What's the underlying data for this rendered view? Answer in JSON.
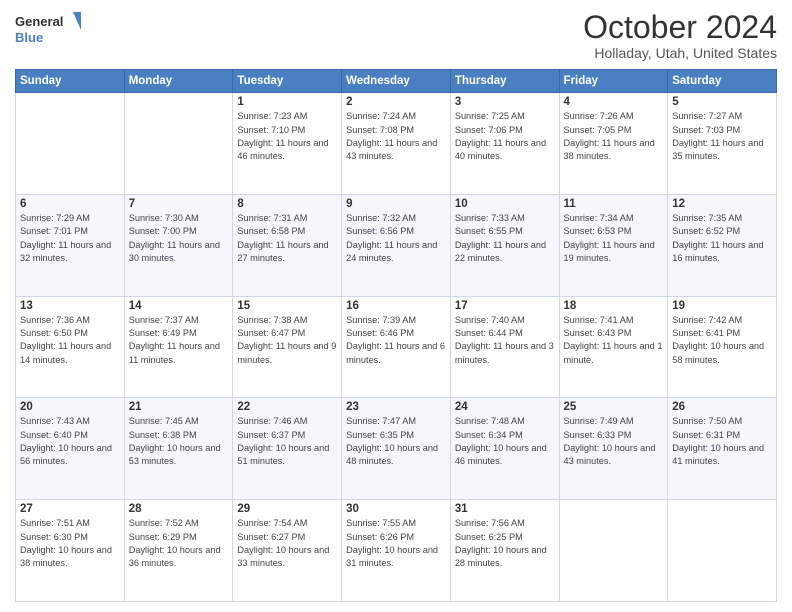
{
  "header": {
    "logo_line1": "General",
    "logo_line2": "Blue",
    "month": "October 2024",
    "location": "Holladay, Utah, United States"
  },
  "weekdays": [
    "Sunday",
    "Monday",
    "Tuesday",
    "Wednesday",
    "Thursday",
    "Friday",
    "Saturday"
  ],
  "weeks": [
    [
      {
        "day": "",
        "sunrise": "",
        "sunset": "",
        "daylight": ""
      },
      {
        "day": "",
        "sunrise": "",
        "sunset": "",
        "daylight": ""
      },
      {
        "day": "1",
        "sunrise": "Sunrise: 7:23 AM",
        "sunset": "Sunset: 7:10 PM",
        "daylight": "Daylight: 11 hours and 46 minutes."
      },
      {
        "day": "2",
        "sunrise": "Sunrise: 7:24 AM",
        "sunset": "Sunset: 7:08 PM",
        "daylight": "Daylight: 11 hours and 43 minutes."
      },
      {
        "day": "3",
        "sunrise": "Sunrise: 7:25 AM",
        "sunset": "Sunset: 7:06 PM",
        "daylight": "Daylight: 11 hours and 40 minutes."
      },
      {
        "day": "4",
        "sunrise": "Sunrise: 7:26 AM",
        "sunset": "Sunset: 7:05 PM",
        "daylight": "Daylight: 11 hours and 38 minutes."
      },
      {
        "day": "5",
        "sunrise": "Sunrise: 7:27 AM",
        "sunset": "Sunset: 7:03 PM",
        "daylight": "Daylight: 11 hours and 35 minutes."
      }
    ],
    [
      {
        "day": "6",
        "sunrise": "Sunrise: 7:29 AM",
        "sunset": "Sunset: 7:01 PM",
        "daylight": "Daylight: 11 hours and 32 minutes."
      },
      {
        "day": "7",
        "sunrise": "Sunrise: 7:30 AM",
        "sunset": "Sunset: 7:00 PM",
        "daylight": "Daylight: 11 hours and 30 minutes."
      },
      {
        "day": "8",
        "sunrise": "Sunrise: 7:31 AM",
        "sunset": "Sunset: 6:58 PM",
        "daylight": "Daylight: 11 hours and 27 minutes."
      },
      {
        "day": "9",
        "sunrise": "Sunrise: 7:32 AM",
        "sunset": "Sunset: 6:56 PM",
        "daylight": "Daylight: 11 hours and 24 minutes."
      },
      {
        "day": "10",
        "sunrise": "Sunrise: 7:33 AM",
        "sunset": "Sunset: 6:55 PM",
        "daylight": "Daylight: 11 hours and 22 minutes."
      },
      {
        "day": "11",
        "sunrise": "Sunrise: 7:34 AM",
        "sunset": "Sunset: 6:53 PM",
        "daylight": "Daylight: 11 hours and 19 minutes."
      },
      {
        "day": "12",
        "sunrise": "Sunrise: 7:35 AM",
        "sunset": "Sunset: 6:52 PM",
        "daylight": "Daylight: 11 hours and 16 minutes."
      }
    ],
    [
      {
        "day": "13",
        "sunrise": "Sunrise: 7:36 AM",
        "sunset": "Sunset: 6:50 PM",
        "daylight": "Daylight: 11 hours and 14 minutes."
      },
      {
        "day": "14",
        "sunrise": "Sunrise: 7:37 AM",
        "sunset": "Sunset: 6:49 PM",
        "daylight": "Daylight: 11 hours and 11 minutes."
      },
      {
        "day": "15",
        "sunrise": "Sunrise: 7:38 AM",
        "sunset": "Sunset: 6:47 PM",
        "daylight": "Daylight: 11 hours and 9 minutes."
      },
      {
        "day": "16",
        "sunrise": "Sunrise: 7:39 AM",
        "sunset": "Sunset: 6:46 PM",
        "daylight": "Daylight: 11 hours and 6 minutes."
      },
      {
        "day": "17",
        "sunrise": "Sunrise: 7:40 AM",
        "sunset": "Sunset: 6:44 PM",
        "daylight": "Daylight: 11 hours and 3 minutes."
      },
      {
        "day": "18",
        "sunrise": "Sunrise: 7:41 AM",
        "sunset": "Sunset: 6:43 PM",
        "daylight": "Daylight: 11 hours and 1 minute."
      },
      {
        "day": "19",
        "sunrise": "Sunrise: 7:42 AM",
        "sunset": "Sunset: 6:41 PM",
        "daylight": "Daylight: 10 hours and 58 minutes."
      }
    ],
    [
      {
        "day": "20",
        "sunrise": "Sunrise: 7:43 AM",
        "sunset": "Sunset: 6:40 PM",
        "daylight": "Daylight: 10 hours and 56 minutes."
      },
      {
        "day": "21",
        "sunrise": "Sunrise: 7:45 AM",
        "sunset": "Sunset: 6:38 PM",
        "daylight": "Daylight: 10 hours and 53 minutes."
      },
      {
        "day": "22",
        "sunrise": "Sunrise: 7:46 AM",
        "sunset": "Sunset: 6:37 PM",
        "daylight": "Daylight: 10 hours and 51 minutes."
      },
      {
        "day": "23",
        "sunrise": "Sunrise: 7:47 AM",
        "sunset": "Sunset: 6:35 PM",
        "daylight": "Daylight: 10 hours and 48 minutes."
      },
      {
        "day": "24",
        "sunrise": "Sunrise: 7:48 AM",
        "sunset": "Sunset: 6:34 PM",
        "daylight": "Daylight: 10 hours and 46 minutes."
      },
      {
        "day": "25",
        "sunrise": "Sunrise: 7:49 AM",
        "sunset": "Sunset: 6:33 PM",
        "daylight": "Daylight: 10 hours and 43 minutes."
      },
      {
        "day": "26",
        "sunrise": "Sunrise: 7:50 AM",
        "sunset": "Sunset: 6:31 PM",
        "daylight": "Daylight: 10 hours and 41 minutes."
      }
    ],
    [
      {
        "day": "27",
        "sunrise": "Sunrise: 7:51 AM",
        "sunset": "Sunset: 6:30 PM",
        "daylight": "Daylight: 10 hours and 38 minutes."
      },
      {
        "day": "28",
        "sunrise": "Sunrise: 7:52 AM",
        "sunset": "Sunset: 6:29 PM",
        "daylight": "Daylight: 10 hours and 36 minutes."
      },
      {
        "day": "29",
        "sunrise": "Sunrise: 7:54 AM",
        "sunset": "Sunset: 6:27 PM",
        "daylight": "Daylight: 10 hours and 33 minutes."
      },
      {
        "day": "30",
        "sunrise": "Sunrise: 7:55 AM",
        "sunset": "Sunset: 6:26 PM",
        "daylight": "Daylight: 10 hours and 31 minutes."
      },
      {
        "day": "31",
        "sunrise": "Sunrise: 7:56 AM",
        "sunset": "Sunset: 6:25 PM",
        "daylight": "Daylight: 10 hours and 28 minutes."
      },
      {
        "day": "",
        "sunrise": "",
        "sunset": "",
        "daylight": ""
      },
      {
        "day": "",
        "sunrise": "",
        "sunset": "",
        "daylight": ""
      }
    ]
  ]
}
